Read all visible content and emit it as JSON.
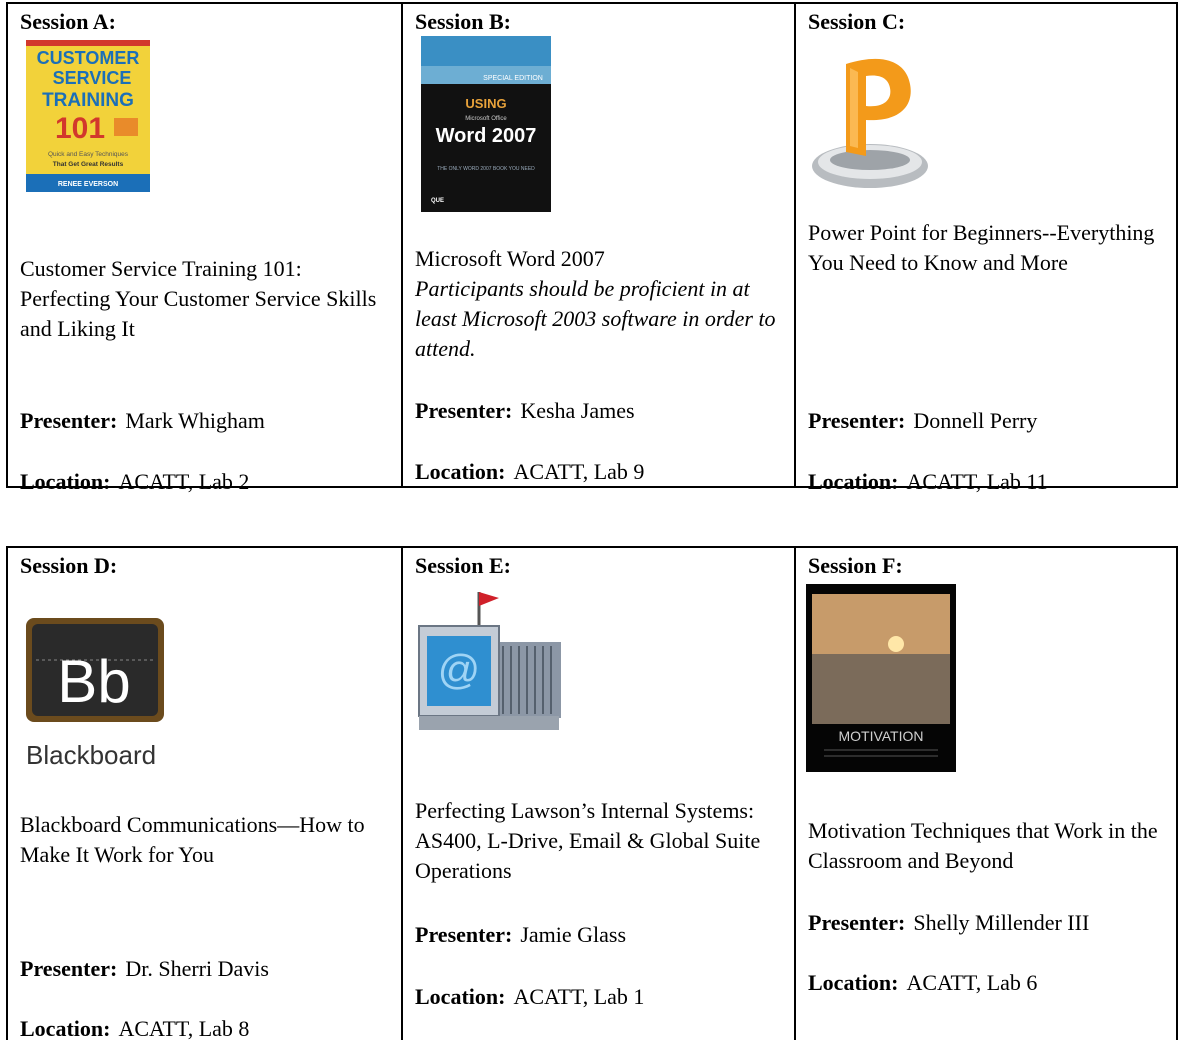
{
  "sessions": [
    {
      "label": "Session A:",
      "cover": {
        "lines": [
          "CUSTOMER",
          "SERVICE",
          "TRAINING",
          "101"
        ],
        "tag1": "Quick and Easy Techniques",
        "tag2": "That Get Great Results",
        "author": "RENEE EVERSON"
      },
      "title": "Customer Service Training 101: Perfecting Your Customer Service Skills and Liking It",
      "note": "",
      "presenter_label": "Presenter:",
      "presenter": "Mark Whigham",
      "location_label": "Location:",
      "location": "ACATT, Lab 2"
    },
    {
      "label": "Session B:",
      "cover": {
        "edition": "SPECIAL EDITION",
        "using": "USING",
        "small": "Microsoft Office",
        "main": "Word 2007",
        "tagline": "THE ONLY WORD 2007 BOOK YOU NEED",
        "publisher": "QUE"
      },
      "title": "Microsoft Word 2007",
      "note": "Participants should be proficient in at least Microsoft 2003 software in order to attend.",
      "presenter_label": "Presenter:",
      "presenter": "Kesha James",
      "location_label": "Location:",
      "location": "ACATT, Lab  9"
    },
    {
      "label": "Session C:",
      "title": "Power Point for Beginners--Everything You Need to Know and More",
      "note": "",
      "presenter_label": "Presenter:",
      "presenter": "Donnell Perry",
      "location_label": "Location:",
      "location": "ACATT, Lab  11"
    },
    {
      "label": "Session D:",
      "logo": {
        "mark": "Bb",
        "word": "Blackboard"
      },
      "title": "Blackboard Communications—How to Make It Work for You",
      "note": "",
      "presenter_label": "Presenter:",
      "presenter": "Dr. Sherri Davis",
      "location_label": "Location:",
      "location": "ACATT, Lab 8"
    },
    {
      "label": "Session E:",
      "icon": "@",
      "title": "Perfecting Lawson’s Internal Systems:  AS400, L-Drive, Email & Global Suite Operations",
      "note": "",
      "presenter_label": "Presenter:",
      "presenter": "Jamie Glass",
      "location_label": "Location:",
      "location": "ACATT, Lab 1"
    },
    {
      "label": "Session F:",
      "poster": {
        "word": "MOTIVATION"
      },
      "title": "Motivation Techniques that Work in the Classroom and Beyond",
      "note": "",
      "presenter_label": "Presenter:",
      "presenter": "Shelly Millender III",
      "location_label": "Location:",
      "location": "ACATT, Lab  6"
    }
  ]
}
